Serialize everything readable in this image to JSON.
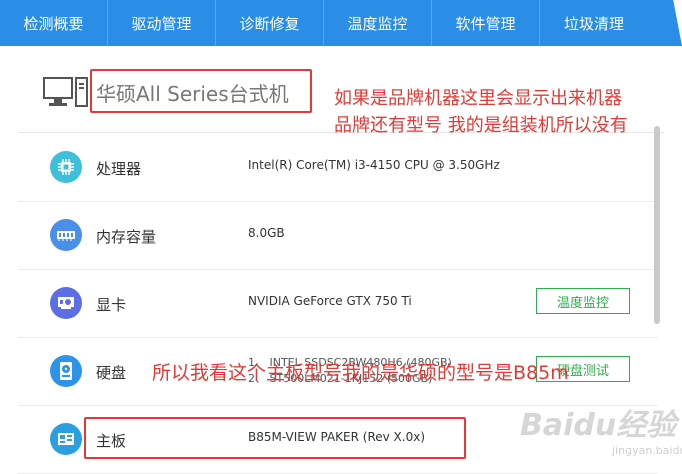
{
  "tabs": [
    {
      "label": "检测概要"
    },
    {
      "label": "驱动管理"
    },
    {
      "label": "诊断修复"
    },
    {
      "label": "温度监控"
    },
    {
      "label": "软件管理"
    },
    {
      "label": "垃圾清理"
    }
  ],
  "machine": {
    "name": "华硕All Series台式机",
    "icon": "desktop-computer-icon"
  },
  "annotations": {
    "top_line1": "如果是品牌机器这里会显示出来机器",
    "top_line2": "品牌还有型号 我的是组装机所以没有",
    "middle": "所以我看这个主板型号我的是华硕的型号是B85m"
  },
  "hardware": [
    {
      "label": "处理器",
      "value": "Intel(R) Core(TM) i3-4150 CPU @ 3.50GHz",
      "icon": "cpu-icon",
      "icon_color": "#3fbfdc"
    },
    {
      "label": "内存容量",
      "value": "8.0GB",
      "icon": "memory-icon",
      "icon_color": "#4a8fe8"
    },
    {
      "label": "显卡",
      "value": "NVIDIA GeForce GTX 750 Ti",
      "icon": "graphics-card-icon",
      "icon_color": "#5b6ee6",
      "button": "温度监控"
    },
    {
      "label": "硬盘",
      "value_line1": "1、 INTEL SSDSC2BW480H6 (480GB)",
      "value_line2": "2、 ST500LM021-1KJ152 (500GB)",
      "icon": "hard-disk-icon",
      "icon_color": "#2d93e8",
      "button": "硬盘测试"
    },
    {
      "label": "主板",
      "value": "B85M-VIEW PAKER (Rev X.0x)",
      "icon": "motherboard-icon",
      "icon_color": "#2aa0e0"
    }
  ],
  "watermark": {
    "logo": "Baidu经验",
    "sub": "jingyan.baidu.com"
  },
  "colors": {
    "tab_bar": "#2a8ee6",
    "annotation": "#e53935",
    "button_green": "#2fae4c"
  }
}
